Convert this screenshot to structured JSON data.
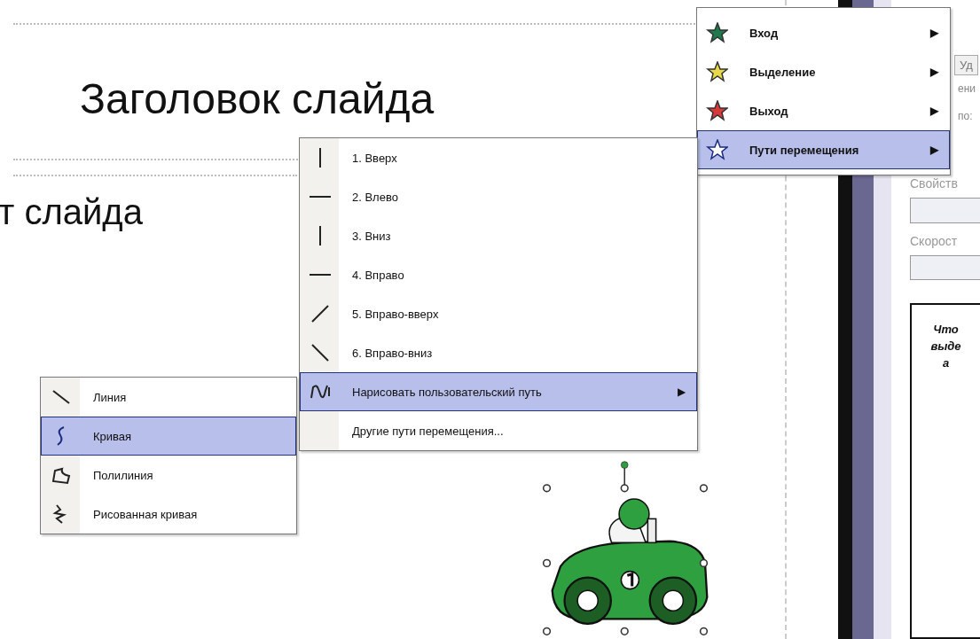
{
  "slide": {
    "title": "Заголовок слайда",
    "text": "т слайда"
  },
  "effect_menu": {
    "items": [
      {
        "label": "Вход",
        "kind": "entrance",
        "arrow": "▶",
        "selected": false
      },
      {
        "label": "Выделение",
        "kind": "emphasis",
        "arrow": "▶",
        "selected": false
      },
      {
        "label": "Выход",
        "kind": "exit",
        "arrow": "▶",
        "selected": false
      },
      {
        "label": "Пути перемещения",
        "kind": "path",
        "arrow": "▶",
        "selected": true
      }
    ]
  },
  "path_menu": {
    "items": [
      {
        "label": "1. Вверх",
        "kind": "up",
        "selected": false
      },
      {
        "label": "2. Влево",
        "kind": "left",
        "selected": false
      },
      {
        "label": "3. Вниз",
        "kind": "down",
        "selected": false
      },
      {
        "label": "4. Вправо",
        "kind": "right",
        "selected": false
      },
      {
        "label": "5. Вправо-вверх",
        "kind": "upright",
        "selected": false
      },
      {
        "label": "6. Вправо-вниз",
        "kind": "downright",
        "selected": false
      },
      {
        "label": "Нарисовать пользовательский путь",
        "kind": "custom",
        "arrow": "▶",
        "selected": true
      },
      {
        "label": "Другие пути перемещения...",
        "kind": "more",
        "selected": false
      }
    ]
  },
  "custom_path_menu": {
    "items": [
      {
        "label": "Линия",
        "kind": "line",
        "selected": false
      },
      {
        "label": "Кривая",
        "kind": "curve",
        "selected": true
      },
      {
        "label": "Полилиния",
        "kind": "polyline",
        "selected": false
      },
      {
        "label": "Рисованная кривая",
        "kind": "scribble",
        "selected": false
      }
    ]
  },
  "task_pane": {
    "button": "Уд",
    "fragments": [
      "ени",
      "по:"
    ],
    "fields": [
      {
        "label": "Свойств"
      },
      {
        "label": "Скорост"
      }
    ],
    "hint_lines": [
      "Что",
      "выде",
      "а"
    ]
  }
}
